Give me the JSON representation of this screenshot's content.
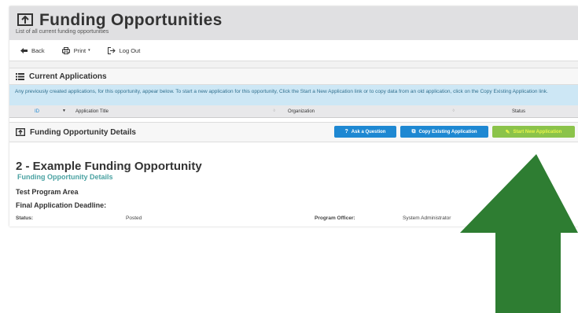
{
  "header": {
    "title": "Funding Opportunities",
    "subtitle": "List of all current funding opportunities"
  },
  "toolbar": {
    "back": "Back",
    "print": "Print",
    "logout": "Log Out"
  },
  "current_applications": {
    "title": "Current Applications",
    "info": "Any previously created applications, for this opportunity, appear below. To start a new application for this opportunity, Click the Start a New Application link or to copy data from an old application, click on the Copy Existing Application link.",
    "columns": [
      "ID",
      "Application Title",
      "Organization",
      "Status"
    ]
  },
  "details": {
    "title": "Funding Opportunity Details",
    "ask_question": "Ask a Question",
    "copy_existing": "Copy Existing Application",
    "start_new": "Start New Application",
    "opportunity_title": "2 - Example Funding Opportunity",
    "subtitle": "Funding Opportunity Details",
    "program_area": "Test Program Area",
    "deadline_label": "Final Application Deadline:",
    "status_label": "Status:",
    "status_value": "Posted",
    "officer_label": "Program Officer:",
    "officer_value": "System Administrator"
  },
  "colors": {
    "header_bg": "#e0e0e2",
    "info_bg": "#cde7f5",
    "ask_btn": "#1e88d2",
    "copy_btn": "#1e88d2",
    "start_btn": "#8bc34a",
    "arrow": "#2e7d32",
    "subtitle_teal": "#4aa2a2"
  }
}
